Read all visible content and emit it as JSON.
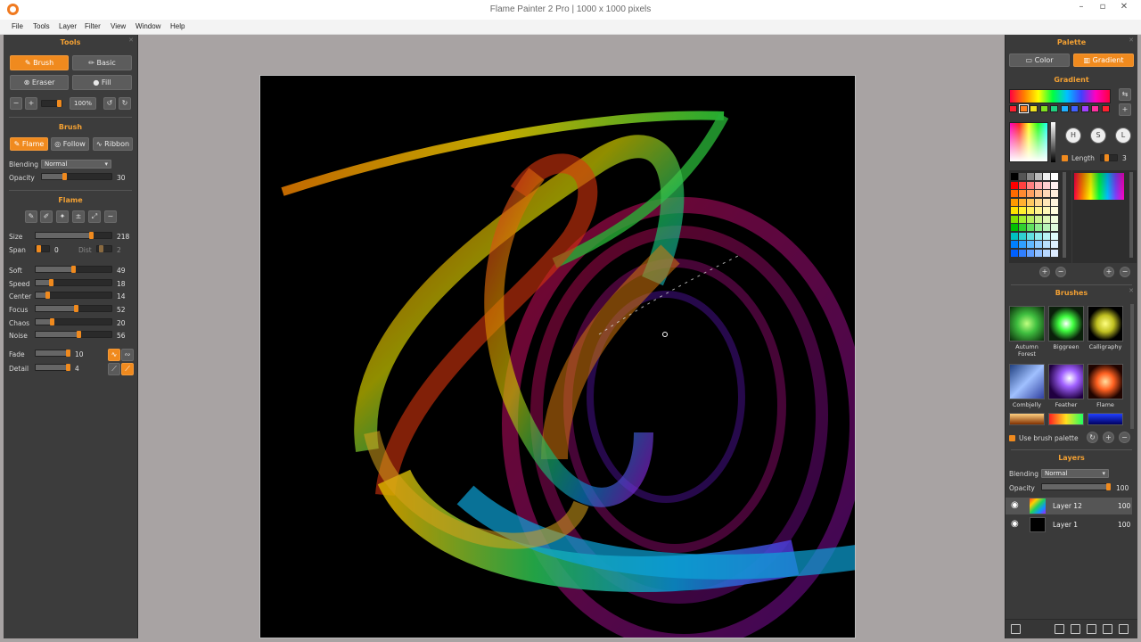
{
  "window": {
    "title": "Flame Painter 2 Pro | 1000 x 1000 pixels"
  },
  "menu": [
    "File",
    "Tools",
    "Layer",
    "Filter",
    "View",
    "Window",
    "Help"
  ],
  "tools": {
    "title": "Tools",
    "brush_label": "Brush",
    "basic_label": "Basic",
    "eraser_label": "Eraser",
    "fill_label": "Fill",
    "zoom_value": "100%"
  },
  "brush": {
    "title": "Brush",
    "flame_label": "Flame",
    "follow_label": "Follow",
    "ribbon_label": "Ribbon",
    "blending_label": "Blending",
    "blending_value": "Normal",
    "opacity_label": "Opacity",
    "opacity_value": "30",
    "opacity_level": 0.3
  },
  "flame": {
    "title": "Flame",
    "size": {
      "label": "Size",
      "value": "218",
      "level": 0.73
    },
    "span": {
      "label": "Span",
      "value": "0"
    },
    "dist": {
      "label": "Dist",
      "value": "2"
    },
    "params": [
      {
        "label": "Soft",
        "value": "49",
        "level": 0.49
      },
      {
        "label": "Speed",
        "value": "18",
        "level": 0.18
      },
      {
        "label": "Center",
        "value": "14",
        "level": 0.14
      },
      {
        "label": "Focus",
        "value": "52",
        "level": 0.52
      },
      {
        "label": "Chaos",
        "value": "20",
        "level": 0.2
      },
      {
        "label": "Noise",
        "value": "56",
        "level": 0.56
      }
    ],
    "fade": {
      "label": "Fade",
      "value": "10"
    },
    "detail": {
      "label": "Detail",
      "value": "4"
    }
  },
  "palette": {
    "title": "Palette",
    "color_tab": "Color",
    "gradient_tab": "Gradient",
    "gradient_title": "Gradient",
    "hsl": [
      "H",
      "S",
      "L"
    ],
    "length_label": "Length",
    "length_value": "3"
  },
  "brushes": {
    "title": "Brushes",
    "items": [
      {
        "name_line1": "Autumn",
        "name_line2": "Forest"
      },
      {
        "name_line1": "Biggreen",
        "name_line2": ""
      },
      {
        "name_line1": "Calligraphy",
        "name_line2": ""
      },
      {
        "name_line1": "Combjelly",
        "name_line2": ""
      },
      {
        "name_line1": "Feather",
        "name_line2": ""
      },
      {
        "name_line1": "Flame",
        "name_line2": ""
      }
    ],
    "use_palette_label": "Use brush palette"
  },
  "layers": {
    "title": "Layers",
    "blending_label": "Blending",
    "blending_value": "Normal",
    "opacity_label": "Opacity",
    "opacity_value": "100",
    "items": [
      {
        "name": "Layer 12",
        "opacity": "100"
      },
      {
        "name": "Layer 1",
        "opacity": "100"
      }
    ]
  },
  "colors": {
    "accent": "#f08a1e",
    "panel": "#3c3c3c",
    "canvas_bg": "#000000",
    "workspace": "#a8a3a3"
  }
}
